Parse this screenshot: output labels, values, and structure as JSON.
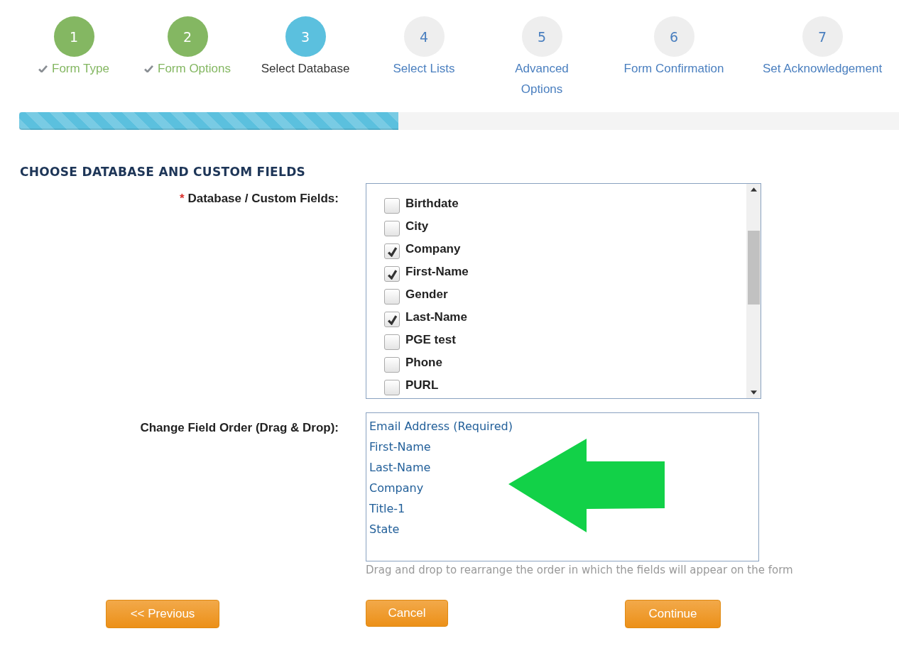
{
  "steps": [
    {
      "number": "1",
      "label": "Form Type",
      "completed": true,
      "selected": false
    },
    {
      "number": "2",
      "label": "Form Options",
      "completed": true,
      "selected": false
    },
    {
      "number": "3",
      "label": "Select Database",
      "completed": false,
      "selected": true
    },
    {
      "number": "4",
      "label": "Select Lists",
      "completed": false,
      "selected": false
    },
    {
      "number": "5",
      "label": "Advanced Options",
      "completed": false,
      "selected": false
    },
    {
      "number": "6",
      "label": "Form Confirmation",
      "completed": false,
      "selected": false
    },
    {
      "number": "7",
      "label": "Set Acknowledgement",
      "completed": false,
      "selected": false
    }
  ],
  "progress": {
    "level": 0.431
  },
  "section_title": "CHOOSE DATABASE AND CUSTOM FIELDS",
  "custom_fields": {
    "required_mark": "*",
    "label": "Database / Custom Fields:",
    "items": [
      {
        "label": "Birthdate",
        "checked": false
      },
      {
        "label": "City",
        "checked": false
      },
      {
        "label": "Company",
        "checked": true
      },
      {
        "label": "First-Name",
        "checked": true
      },
      {
        "label": "Gender",
        "checked": false
      },
      {
        "label": "Last-Name",
        "checked": true
      },
      {
        "label": "PGE test",
        "checked": false
      },
      {
        "label": "Phone",
        "checked": false
      },
      {
        "label": "PURL",
        "checked": false
      }
    ]
  },
  "field_order": {
    "label": "Change Field Order (Drag & Drop):",
    "items": [
      "Email Address (Required)",
      "First-Name",
      "Last-Name",
      "Company",
      "Title-1",
      "State"
    ],
    "hint": "Drag and drop to rearrange the order in which the fields will appear on the form"
  },
  "buttons": [
    {
      "label": "<< Previous",
      "kind": "previous"
    },
    {
      "label": "Cancel",
      "kind": "cancel"
    },
    {
      "label": "Continue",
      "kind": "continue"
    }
  ]
}
